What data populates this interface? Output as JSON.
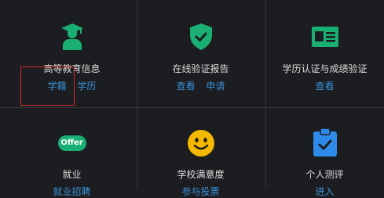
{
  "cells": [
    {
      "title": "高等教育信息",
      "links": [
        "学籍",
        "学历"
      ],
      "icon": "graduate-icon"
    },
    {
      "title": "在线验证报告",
      "links": [
        "查看",
        "申请"
      ],
      "icon": "shield-check-icon"
    },
    {
      "title": "学历认证与成绩验证",
      "links": [
        "查看"
      ],
      "icon": "id-card-icon"
    },
    {
      "title": "就业",
      "links": [
        "就业招聘"
      ],
      "icon": "offer-icon"
    },
    {
      "title": "学校满意度",
      "links": [
        "参与投票"
      ],
      "icon": "smiley-icon"
    },
    {
      "title": "个人测评",
      "links": [
        "进入"
      ],
      "icon": "clipboard-check-icon"
    }
  ],
  "offer_text": "Offer",
  "colors": {
    "background": "#1b1d20",
    "accent_green": "#1aaf73",
    "link_blue": "#3a8fd6",
    "smiley_yellow": "#f5b800",
    "clipboard_blue": "#2f8bea",
    "highlight_red": "#d22a2a"
  }
}
